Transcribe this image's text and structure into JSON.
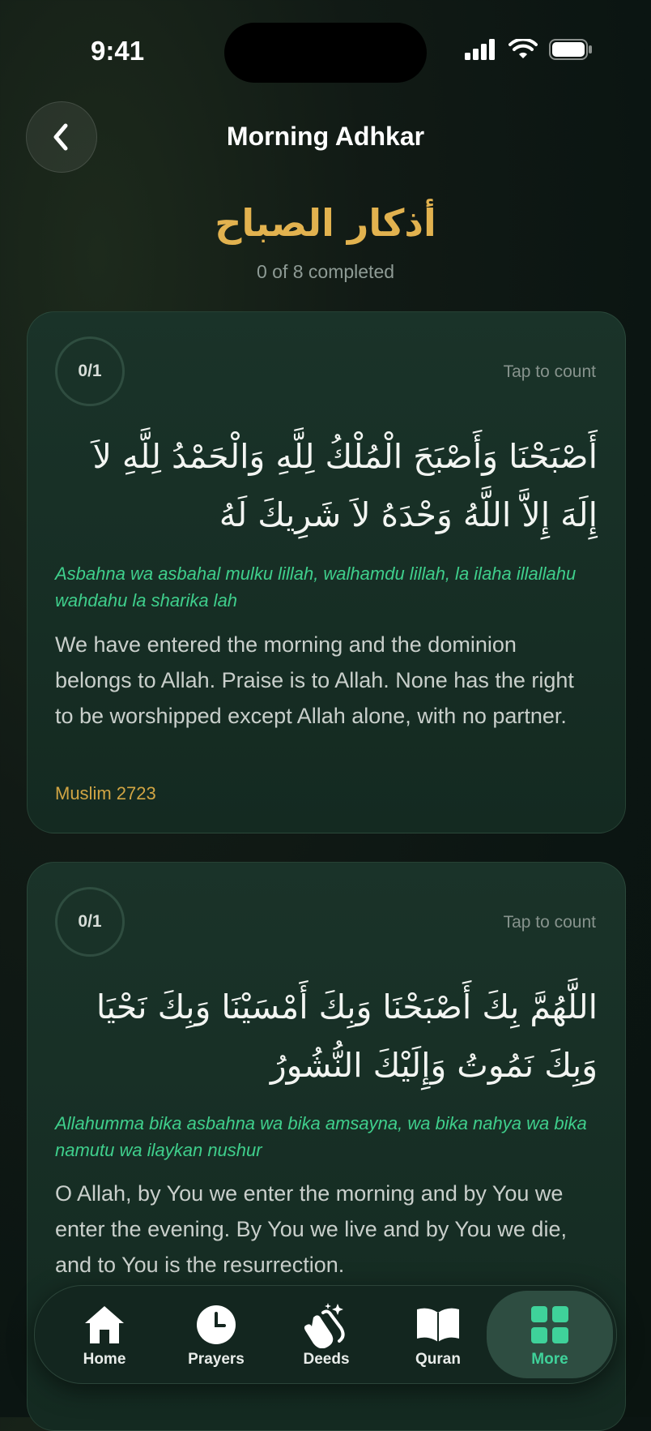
{
  "status": {
    "time": "9:41"
  },
  "header": {
    "title": "Morning Adhkar"
  },
  "page": {
    "arabic_title": "أذكار الصباح",
    "progress": "0 of 8 completed"
  },
  "cards": [
    {
      "counter": "0/1",
      "tap_hint": "Tap to count",
      "arabic": "أَصْبَحْنَا وَأَصْبَحَ الْمُلْكُ لِلَّهِ وَالْحَمْدُ لِلَّهِ لاَ إِلَهَ إِلاَّ اللَّهُ وَحْدَهُ لاَ شَرِيكَ لَهُ",
      "transliteration": "Asbahna wa asbahal mulku lillah, walhamdu lillah, la ilaha illallahu wahdahu la sharika lah",
      "translation": "We have entered the morning and the dominion belongs to Allah. Praise is to Allah. None has the right to be worshipped except Allah alone, with no partner.",
      "source": "Muslim 2723"
    },
    {
      "counter": "0/1",
      "tap_hint": "Tap to count",
      "arabic": "اللَّهُمَّ بِكَ أَصْبَحْنَا وَبِكَ أَمْسَيْنَا وَبِكَ نَحْيَا وَبِكَ نَمُوتُ وَإِلَيْكَ النُّشُورُ",
      "transliteration": "Allahumma bika asbahna wa bika amsayna, wa bika nahya wa bika namutu wa ilaykan nushur",
      "translation": "O Allah, by You we enter the morning and by You we enter the evening. By You we live and by You we die, and to You is the resurrection."
    }
  ],
  "tabs": [
    {
      "label": "Home",
      "icon": "home-icon"
    },
    {
      "label": "Prayers",
      "icon": "clock-icon"
    },
    {
      "label": "Deeds",
      "icon": "clapping-hands-icon"
    },
    {
      "label": "Quran",
      "icon": "open-book-icon"
    },
    {
      "label": "More",
      "icon": "grid-icon",
      "active": true
    }
  ],
  "colors": {
    "accent_gold": "#e2b24f",
    "accent_green": "#3fd29a",
    "background": "#0b1512"
  }
}
